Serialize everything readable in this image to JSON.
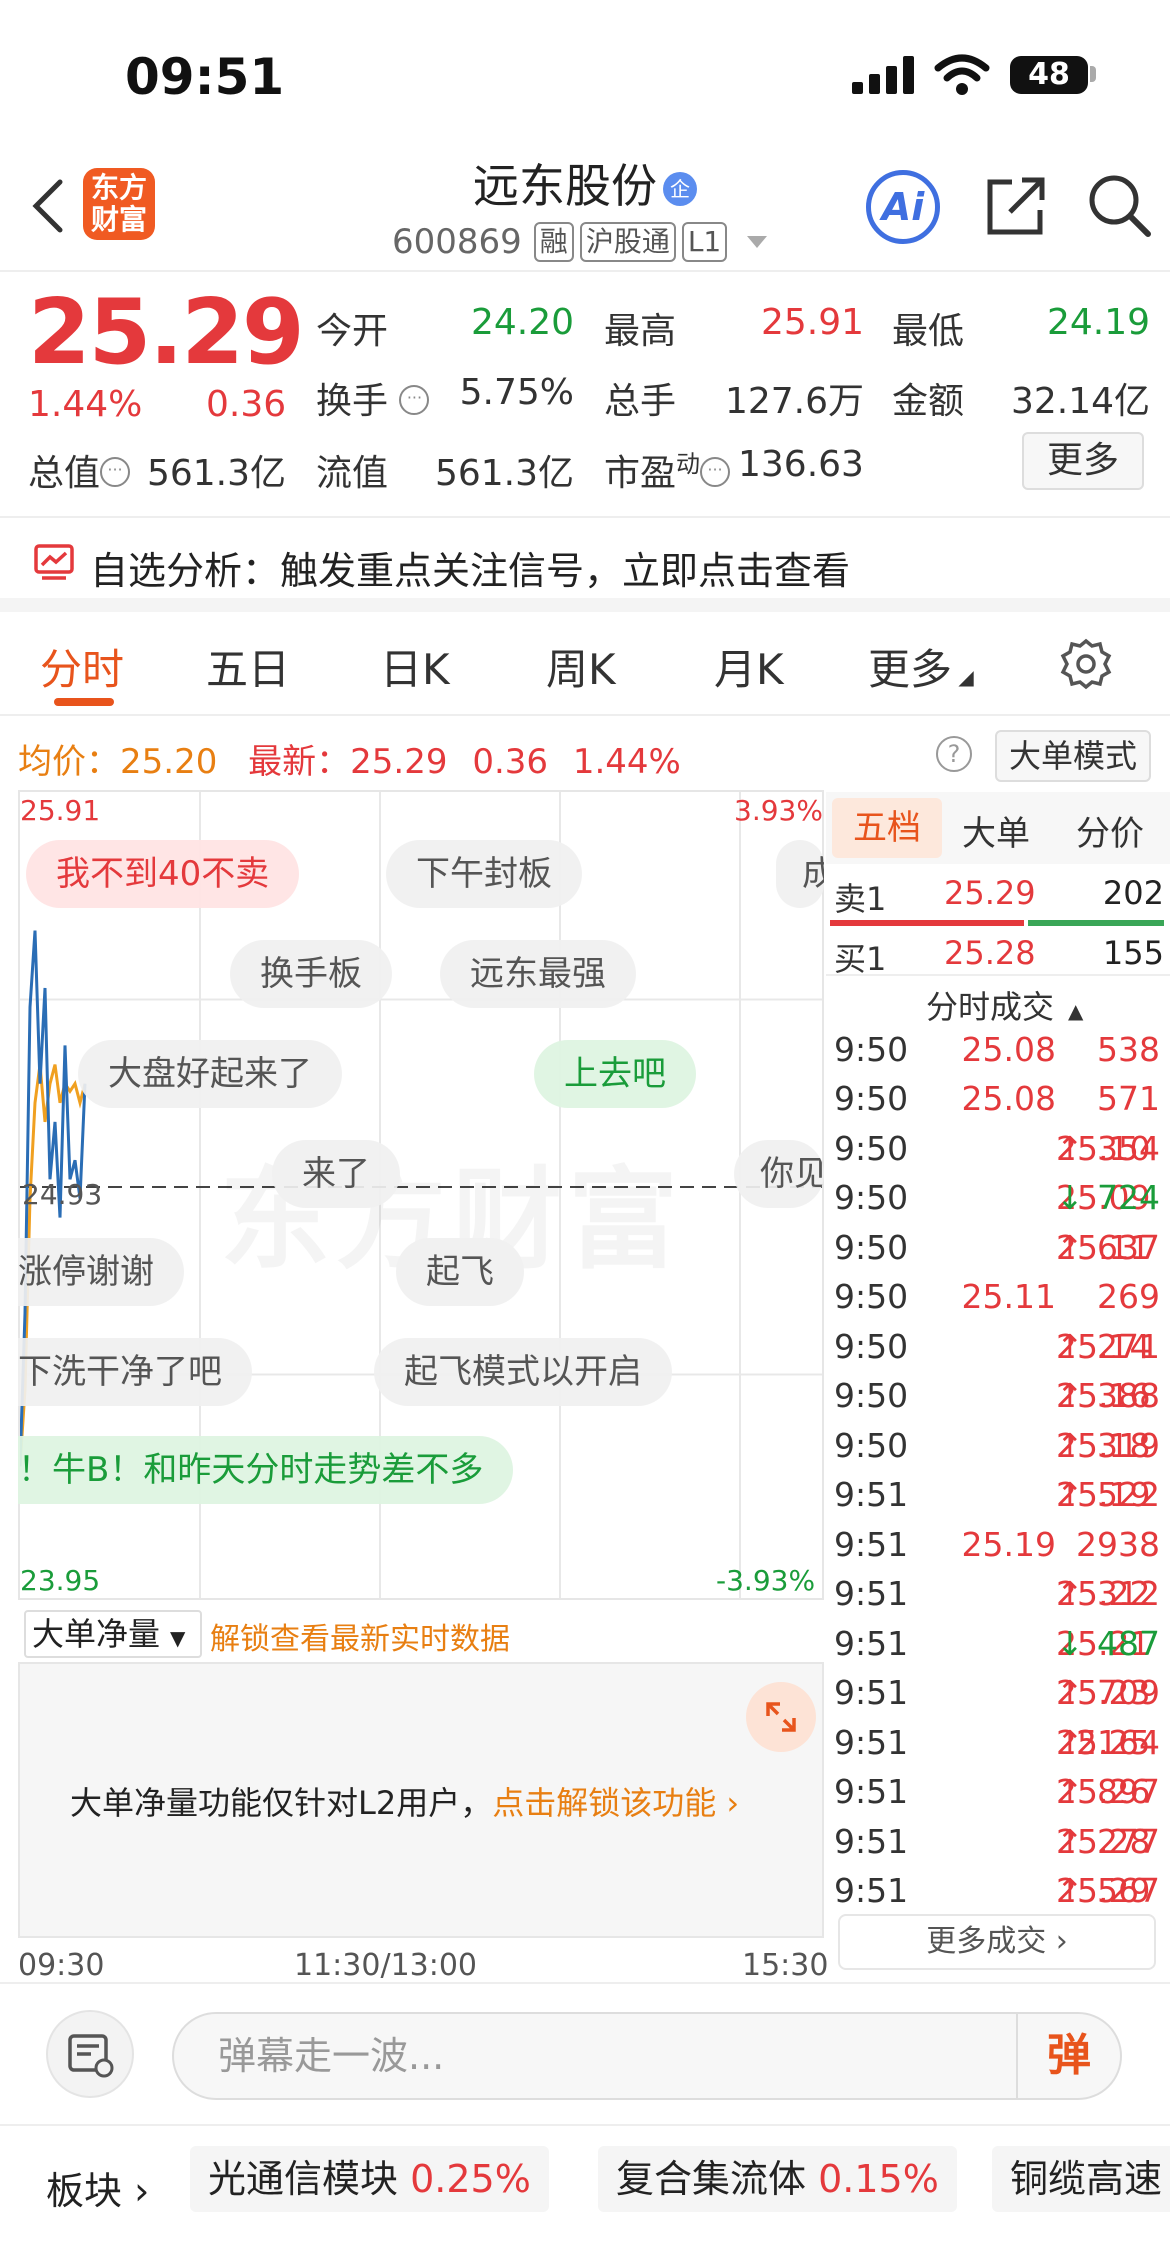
{
  "status": {
    "time": "09:51",
    "battery": "48"
  },
  "header": {
    "logo": [
      "东方",
      "财富"
    ],
    "name": "远东股份",
    "name_badge": "企",
    "code": "600869",
    "tags": [
      "融",
      "沪股通",
      "L1"
    ],
    "ai_label": "Ai"
  },
  "quote": {
    "price": "25.29",
    "change_pct": "1.44%",
    "change": "0.36",
    "items": [
      {
        "k": "今开",
        "v": "24.20",
        "c": "green"
      },
      {
        "k": "最高",
        "v": "25.91",
        "c": "red"
      },
      {
        "k": "最低",
        "v": "24.19",
        "c": "green"
      },
      {
        "k": "换手",
        "v": "5.75%",
        "c": "dark"
      },
      {
        "k": "总手",
        "v": "127.6万",
        "c": "dark"
      },
      {
        "k": "金额",
        "v": "32.14亿",
        "c": "dark"
      },
      {
        "k": "总值",
        "v": "561.3亿",
        "c": "dark"
      },
      {
        "k": "流值",
        "v": "561.3亿",
        "c": "dark"
      },
      {
        "k": "市盈",
        "sup": "动",
        "v": "136.63",
        "c": "dark"
      }
    ],
    "more": "更多"
  },
  "banner": {
    "text": "自选分析：触发重点关注信号，立即点击查看"
  },
  "tabs": [
    "分时",
    "五日",
    "日K",
    "周K",
    "月K",
    "更多"
  ],
  "avg_row": {
    "avg_label": "均价：",
    "avg": "25.20",
    "latest_label": "最新：",
    "latest": "25.29",
    "chg": "0.36",
    "pct": "1.44%",
    "help": "?",
    "mode_btn": "大单模式"
  },
  "chart": {
    "watermark": "东方财富",
    "y_high": "25.91",
    "y_low": "23.95",
    "y_ref": "24.93",
    "pct_high": "3.93%",
    "pct_low": "-3.93%",
    "times": [
      "09:30",
      "11:30/13:00",
      "15:30"
    ]
  },
  "chart_data": {
    "type": "line",
    "ylim": [
      23.95,
      25.91
    ],
    "reference": 24.93,
    "series": [
      {
        "values": [
          24.2,
          24.6,
          25.4,
          25.6,
          25.2,
          25.45,
          24.95,
          25.1,
          24.85,
          25.3,
          24.95,
          25.0,
          24.9,
          25.2
        ]
      },
      {
        "values": [
          24.2,
          24.4,
          24.9,
          25.15,
          25.25,
          25.1,
          25.2,
          25.25,
          25.15,
          25.2,
          25.18,
          25.2,
          25.15,
          25.2
        ]
      }
    ]
  },
  "danmu": [
    {
      "text": "我不到40不卖",
      "style": "red"
    },
    {
      "text": "下午封板",
      "style": "gray"
    },
    {
      "text": "成",
      "style": "gray"
    },
    {
      "text": "换手板",
      "style": "gray"
    },
    {
      "text": "远东最强",
      "style": "gray"
    },
    {
      "text": "大盘好起来了",
      "style": "gray"
    },
    {
      "text": "上去吧",
      "style": "green"
    },
    {
      "text": "来了",
      "style": "gray"
    },
    {
      "text": "你见",
      "style": "gray"
    },
    {
      "text": "涨停谢谢",
      "style": "gray"
    },
    {
      "text": "起飞",
      "style": "gray"
    },
    {
      "text": "下洗干净了吧",
      "style": "gray"
    },
    {
      "text": "起飞模式以开启",
      "style": "gray"
    },
    {
      "text": "！牛B！和昨天分时走势差不多",
      "style": "green"
    }
  ],
  "big_order": {
    "select": "大单净量",
    "unlock": "解锁查看最新实时数据",
    "msg": "大单净量功能仅针对L2用户，",
    "msg_link": "点击解锁该功能"
  },
  "order_book": {
    "tabs": [
      "五档",
      "大单",
      "分价"
    ],
    "sell": {
      "label": "卖1",
      "price": "25.29",
      "vol": "202"
    },
    "buy": {
      "label": "买1",
      "price": "25.28",
      "vol": "155"
    }
  },
  "trades_header": "分时成交",
  "trades": [
    {
      "t": "9:50",
      "p": "25.08",
      "d": "",
      "v": "538",
      "c": "red"
    },
    {
      "t": "9:50",
      "p": "25.08",
      "d": "",
      "v": "571",
      "c": "red"
    },
    {
      "t": "9:50",
      "p": "25.10",
      "d": "↑",
      "v": "354",
      "c": "red"
    },
    {
      "t": "9:50",
      "p": "25.09",
      "d": "↓",
      "v": "724",
      "c": "green"
    },
    {
      "t": "9:50",
      "p": "25.11",
      "d": "↑",
      "v": "637",
      "c": "red"
    },
    {
      "t": "9:50",
      "p": "25.11",
      "d": "",
      "v": "269",
      "c": "red"
    },
    {
      "t": "9:50",
      "p": "25.14",
      "d": "↑",
      "v": "271",
      "c": "red"
    },
    {
      "t": "9:50",
      "p": "25.16",
      "d": "↑",
      "v": "388",
      "c": "red"
    },
    {
      "t": "9:50",
      "p": "25.18",
      "d": "↑",
      "v": "319",
      "c": "red"
    },
    {
      "t": "9:51",
      "p": "25.19",
      "d": "↑",
      "v": "522",
      "c": "red"
    },
    {
      "t": "9:51",
      "p": "25.19",
      "d": "",
      "v": "2938",
      "c": "red"
    },
    {
      "t": "9:51",
      "p": "25.22",
      "d": "↑",
      "v": "312",
      "c": "red"
    },
    {
      "t": "9:51",
      "p": "25.21",
      "d": "↓",
      "v": "487",
      "c": "green"
    },
    {
      "t": "9:51",
      "p": "25.23",
      "d": "↑",
      "v": "709",
      "c": "red"
    },
    {
      "t": "9:51",
      "p": "25.25",
      "d": "↑",
      "v": "2164",
      "c": "red"
    },
    {
      "t": "9:51",
      "p": "25.26",
      "d": "↑",
      "v": "897",
      "c": "red"
    },
    {
      "t": "9:51",
      "p": "25.28",
      "d": "↑",
      "v": "277",
      "c": "red"
    },
    {
      "t": "9:51",
      "p": "25.29",
      "d": "↑",
      "v": "567",
      "c": "red"
    }
  ],
  "more_trades": "更多成交",
  "bottom": {
    "placeholder": "弹幕走一波...",
    "send": "弹",
    "sector_label": "板块",
    "sectors": [
      {
        "name": "光通信模块",
        "pct": "0.25%"
      },
      {
        "name": "复合集流体",
        "pct": "0.15%"
      },
      {
        "name": "铜缆高速",
        "pct": ""
      }
    ]
  },
  "colors": {
    "up": "#e4393c",
    "down": "#1a9c3a",
    "accent": "#e8541c",
    "avg_line": "#f0a020",
    "price_line": "#2a6db5"
  }
}
